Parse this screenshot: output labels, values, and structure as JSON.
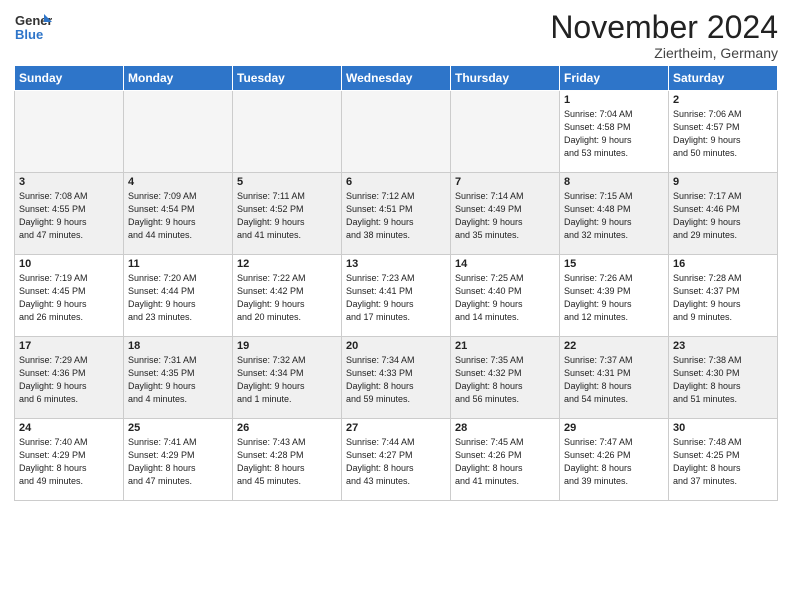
{
  "header": {
    "logo_line1": "General",
    "logo_line2": "Blue",
    "month": "November 2024",
    "location": "Ziertheim, Germany"
  },
  "weekdays": [
    "Sunday",
    "Monday",
    "Tuesday",
    "Wednesday",
    "Thursday",
    "Friday",
    "Saturday"
  ],
  "weeks": [
    [
      {
        "day": "",
        "info": ""
      },
      {
        "day": "",
        "info": ""
      },
      {
        "day": "",
        "info": ""
      },
      {
        "day": "",
        "info": ""
      },
      {
        "day": "",
        "info": ""
      },
      {
        "day": "1",
        "info": "Sunrise: 7:04 AM\nSunset: 4:58 PM\nDaylight: 9 hours\nand 53 minutes."
      },
      {
        "day": "2",
        "info": "Sunrise: 7:06 AM\nSunset: 4:57 PM\nDaylight: 9 hours\nand 50 minutes."
      }
    ],
    [
      {
        "day": "3",
        "info": "Sunrise: 7:08 AM\nSunset: 4:55 PM\nDaylight: 9 hours\nand 47 minutes."
      },
      {
        "day": "4",
        "info": "Sunrise: 7:09 AM\nSunset: 4:54 PM\nDaylight: 9 hours\nand 44 minutes."
      },
      {
        "day": "5",
        "info": "Sunrise: 7:11 AM\nSunset: 4:52 PM\nDaylight: 9 hours\nand 41 minutes."
      },
      {
        "day": "6",
        "info": "Sunrise: 7:12 AM\nSunset: 4:51 PM\nDaylight: 9 hours\nand 38 minutes."
      },
      {
        "day": "7",
        "info": "Sunrise: 7:14 AM\nSunset: 4:49 PM\nDaylight: 9 hours\nand 35 minutes."
      },
      {
        "day": "8",
        "info": "Sunrise: 7:15 AM\nSunset: 4:48 PM\nDaylight: 9 hours\nand 32 minutes."
      },
      {
        "day": "9",
        "info": "Sunrise: 7:17 AM\nSunset: 4:46 PM\nDaylight: 9 hours\nand 29 minutes."
      }
    ],
    [
      {
        "day": "10",
        "info": "Sunrise: 7:19 AM\nSunset: 4:45 PM\nDaylight: 9 hours\nand 26 minutes."
      },
      {
        "day": "11",
        "info": "Sunrise: 7:20 AM\nSunset: 4:44 PM\nDaylight: 9 hours\nand 23 minutes."
      },
      {
        "day": "12",
        "info": "Sunrise: 7:22 AM\nSunset: 4:42 PM\nDaylight: 9 hours\nand 20 minutes."
      },
      {
        "day": "13",
        "info": "Sunrise: 7:23 AM\nSunset: 4:41 PM\nDaylight: 9 hours\nand 17 minutes."
      },
      {
        "day": "14",
        "info": "Sunrise: 7:25 AM\nSunset: 4:40 PM\nDaylight: 9 hours\nand 14 minutes."
      },
      {
        "day": "15",
        "info": "Sunrise: 7:26 AM\nSunset: 4:39 PM\nDaylight: 9 hours\nand 12 minutes."
      },
      {
        "day": "16",
        "info": "Sunrise: 7:28 AM\nSunset: 4:37 PM\nDaylight: 9 hours\nand 9 minutes."
      }
    ],
    [
      {
        "day": "17",
        "info": "Sunrise: 7:29 AM\nSunset: 4:36 PM\nDaylight: 9 hours\nand 6 minutes."
      },
      {
        "day": "18",
        "info": "Sunrise: 7:31 AM\nSunset: 4:35 PM\nDaylight: 9 hours\nand 4 minutes."
      },
      {
        "day": "19",
        "info": "Sunrise: 7:32 AM\nSunset: 4:34 PM\nDaylight: 9 hours\nand 1 minute."
      },
      {
        "day": "20",
        "info": "Sunrise: 7:34 AM\nSunset: 4:33 PM\nDaylight: 8 hours\nand 59 minutes."
      },
      {
        "day": "21",
        "info": "Sunrise: 7:35 AM\nSunset: 4:32 PM\nDaylight: 8 hours\nand 56 minutes."
      },
      {
        "day": "22",
        "info": "Sunrise: 7:37 AM\nSunset: 4:31 PM\nDaylight: 8 hours\nand 54 minutes."
      },
      {
        "day": "23",
        "info": "Sunrise: 7:38 AM\nSunset: 4:30 PM\nDaylight: 8 hours\nand 51 minutes."
      }
    ],
    [
      {
        "day": "24",
        "info": "Sunrise: 7:40 AM\nSunset: 4:29 PM\nDaylight: 8 hours\nand 49 minutes."
      },
      {
        "day": "25",
        "info": "Sunrise: 7:41 AM\nSunset: 4:29 PM\nDaylight: 8 hours\nand 47 minutes."
      },
      {
        "day": "26",
        "info": "Sunrise: 7:43 AM\nSunset: 4:28 PM\nDaylight: 8 hours\nand 45 minutes."
      },
      {
        "day": "27",
        "info": "Sunrise: 7:44 AM\nSunset: 4:27 PM\nDaylight: 8 hours\nand 43 minutes."
      },
      {
        "day": "28",
        "info": "Sunrise: 7:45 AM\nSunset: 4:26 PM\nDaylight: 8 hours\nand 41 minutes."
      },
      {
        "day": "29",
        "info": "Sunrise: 7:47 AM\nSunset: 4:26 PM\nDaylight: 8 hours\nand 39 minutes."
      },
      {
        "day": "30",
        "info": "Sunrise: 7:48 AM\nSunset: 4:25 PM\nDaylight: 8 hours\nand 37 minutes."
      }
    ]
  ]
}
